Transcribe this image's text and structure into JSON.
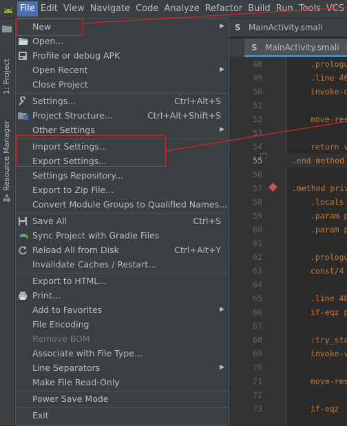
{
  "menubar": {
    "items": [
      "File",
      "Edit",
      "View",
      "Navigate",
      "Code",
      "Analyze",
      "Refactor",
      "Build",
      "Run",
      "Tools",
      "VCS"
    ],
    "active": "File"
  },
  "sidebar": {
    "project_label": "1: Project",
    "resource_label": "Resource Manager"
  },
  "editor": {
    "breadcrumb": "MainActivity.smali",
    "tab_label": "MainActivity.smali",
    "lines": [
      {
        "n": "48",
        "t": ".prologu"
      },
      {
        "n": "49",
        "t": ".line 46"
      },
      {
        "n": "50",
        "t": "invoke-d"
      },
      {
        "n": "51",
        "t": ""
      },
      {
        "n": "52",
        "t": "move-res"
      },
      {
        "n": "53",
        "t": ""
      },
      {
        "n": "54",
        "t": "return v"
      },
      {
        "n": "55",
        "t": ".end method"
      },
      {
        "n": "56",
        "t": ""
      },
      {
        "n": "57",
        "t": ".method priv"
      },
      {
        "n": "58",
        "t": ".locals"
      },
      {
        "n": "59",
        "t": ".param p"
      },
      {
        "n": "60",
        "t": ".param p"
      },
      {
        "n": "61",
        "t": ""
      },
      {
        "n": "62",
        "t": ".prologu"
      },
      {
        "n": "63",
        "t": "const/4"
      },
      {
        "n": "64",
        "t": ""
      },
      {
        "n": "65",
        "t": ".line 48"
      },
      {
        "n": "66",
        "t": "if-eqz p"
      },
      {
        "n": "67",
        "t": ""
      },
      {
        "n": "68",
        "t": ":try_sta"
      },
      {
        "n": "69",
        "t": "invoke-v"
      },
      {
        "n": "70",
        "t": ""
      },
      {
        "n": "71",
        "t": "move-res"
      },
      {
        "n": "72",
        "t": ""
      },
      {
        "n": "73",
        "t": "if-eqz"
      }
    ]
  },
  "file_menu": {
    "new": "New",
    "open": "Open...",
    "profile_apk": "Profile or debug APK",
    "open_recent": "Open Recent",
    "close_project": "Close Project",
    "settings": "Settings...",
    "settings_shortcut": "Ctrl+Alt+S",
    "project_structure": "Project Structure...",
    "project_structure_shortcut": "Ctrl+Alt+Shift+S",
    "other_settings": "Other Settings",
    "import_settings": "Import Settings...",
    "export_settings": "Export Settings...",
    "settings_repository": "Settings Repository...",
    "export_zip": "Export to Zip File...",
    "convert_module_groups": "Convert Module Groups to Qualified Names...",
    "save_all": "Save All",
    "save_all_shortcut": "Ctrl+S",
    "sync_gradle": "Sync Project with Gradle Files",
    "reload_disk": "Reload All from Disk",
    "reload_disk_shortcut": "Ctrl+Alt+Y",
    "invalidate_caches": "Invalidate Caches / Restart...",
    "export_html": "Export to HTML...",
    "print": "Print...",
    "add_favorites": "Add to Favorites",
    "file_encoding": "File Encoding",
    "remove_bom": "Remove BOM",
    "associate_file_type": "Associate with File Type...",
    "line_separators": "Line Separators",
    "make_read_only": "Make File Read-Only",
    "power_save": "Power Save Mode",
    "exit": "Exit"
  },
  "colors": {
    "menu_bg": "#3c3f41",
    "editor_bg": "#2b2b2b",
    "highlight": "#4b6eaf",
    "annotation_red": "#d0272e",
    "keyword": "#cc7832"
  }
}
